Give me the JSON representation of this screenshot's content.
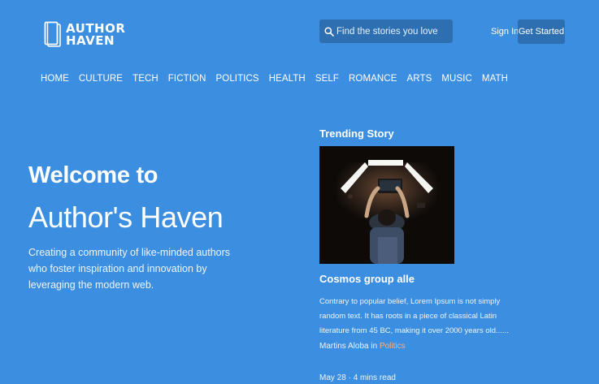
{
  "header": {
    "logo_line1": "AUTHOR",
    "logo_line2": "HAVEN",
    "search_placeholder": "Find the stories you love",
    "signin_label": "Sign In",
    "get_started_label": "Get Started",
    "search_icon": "search-icon",
    "logo_icon": "book-logo-icon"
  },
  "nav": {
    "items": [
      "HOME",
      "CULTURE",
      "TECH",
      "FICTION",
      "POLITICS",
      "HEALTH",
      "SELF",
      "ROMANCE",
      "ARTS",
      "MUSIC",
      "MATH"
    ]
  },
  "hero": {
    "line1": "Welcome to",
    "line2": "Author's Haven",
    "description": "Creating a community of like-minded authors who foster inspiration and innovation by leveraging the modern web."
  },
  "trending": {
    "heading": "Trending Story",
    "title": "Cosmos group alle",
    "excerpt": "Contrary to popular belief, Lorem Ipsum is not simply random text. It has roots in a piece of classical Latin literature from 45 BC, making it over 2000 years old......",
    "author": "Martins Aloba",
    "in_word": "in",
    "category": "Politics",
    "date": "May 28",
    "separator": "·",
    "read_time": "4 mins read"
  },
  "colors": {
    "background": "#3b8ee0",
    "button": "#2d6fb0",
    "category_accent": "#f0b48a"
  }
}
